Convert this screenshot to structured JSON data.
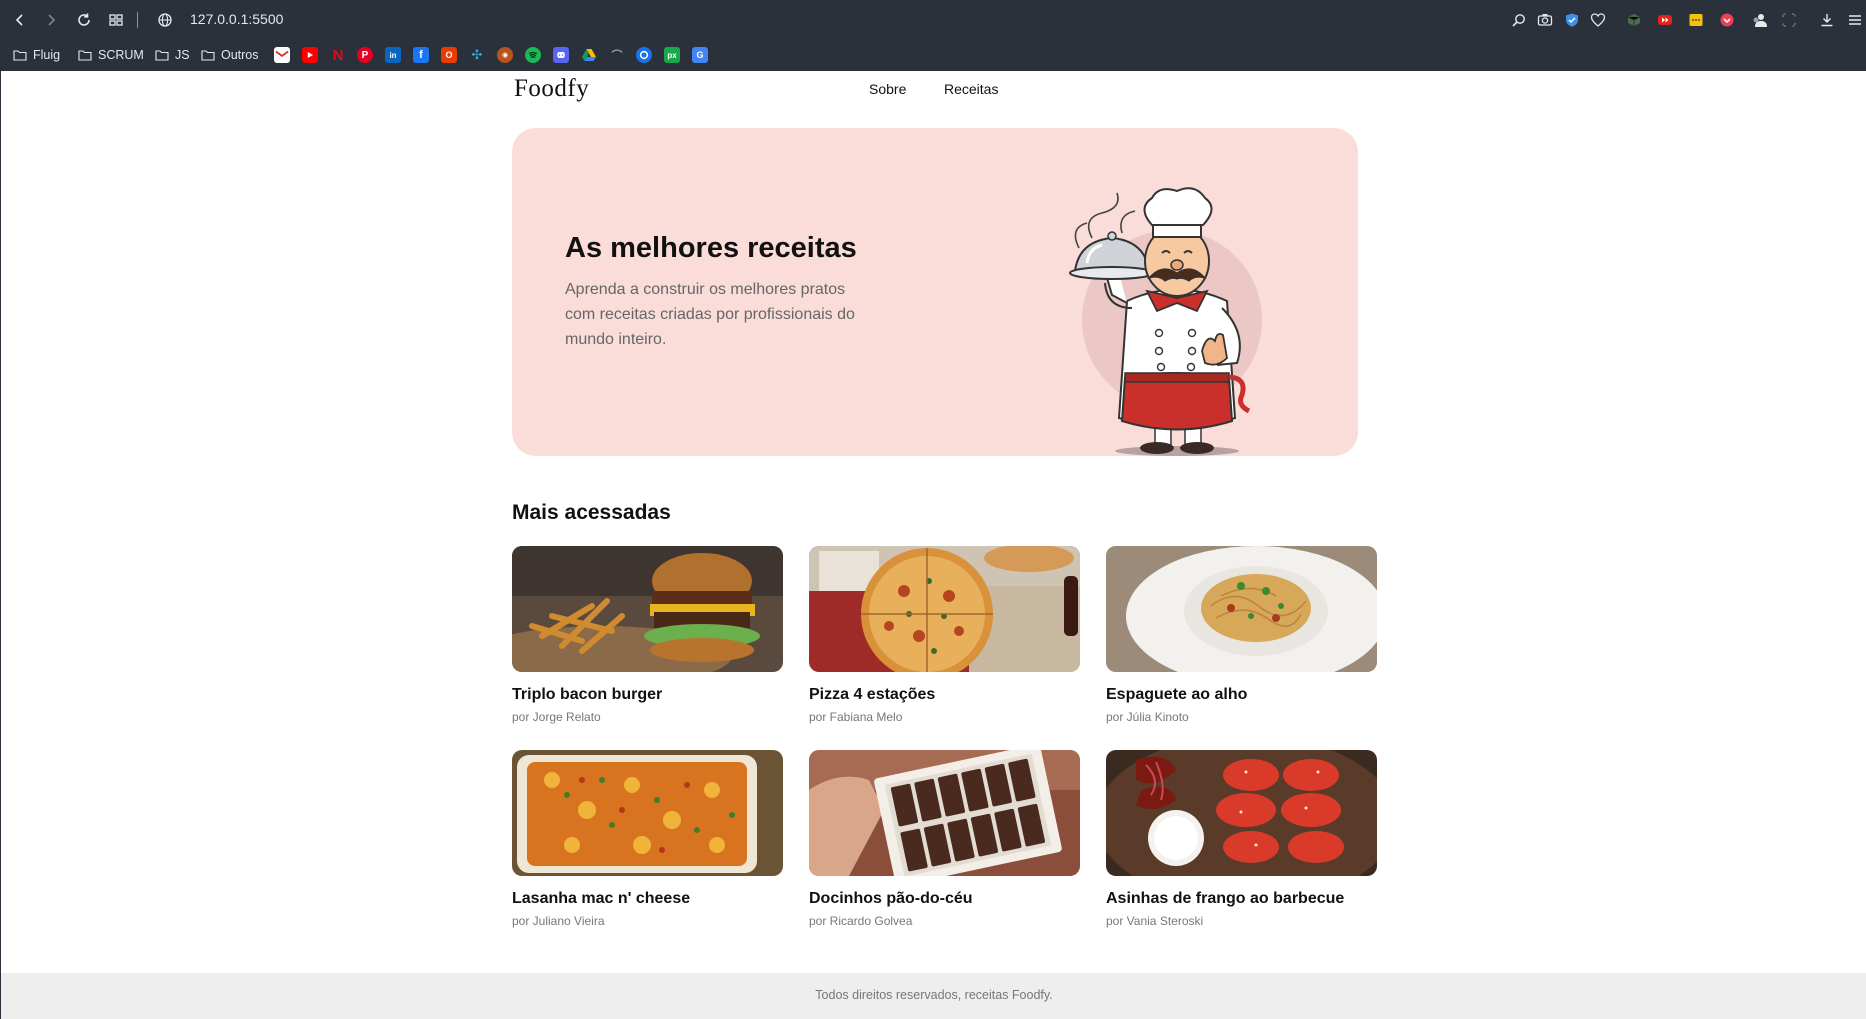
{
  "browser": {
    "url": "127.0.0.1:5500",
    "bookmarks": [
      {
        "label": "Fluig"
      },
      {
        "label": "SCRUM"
      },
      {
        "label": "JS"
      },
      {
        "label": "Outros"
      }
    ],
    "bookmark_icons": [
      "gmail-icon",
      "youtube-icon",
      "netflix-icon",
      "pinterest-icon",
      "linkedin-icon",
      "facebook-icon",
      "office-icon",
      "trello-icon",
      "site-icon",
      "spotify-icon",
      "discord-icon",
      "drive-icon",
      "bookmark-icon",
      "google-icon",
      "pix-icon",
      "translate-icon"
    ]
  },
  "site": {
    "logo": "Foodfy",
    "nav": [
      {
        "label": "Sobre"
      },
      {
        "label": "Receitas"
      }
    ]
  },
  "hero": {
    "title": "As melhores receitas",
    "description": "Aprenda a construir os melhores pratos com receitas criadas por profissionais do mundo inteiro."
  },
  "section": {
    "title": "Mais acessadas"
  },
  "recipes": [
    {
      "title": "Triplo bacon burger",
      "author": "por Jorge Relato"
    },
    {
      "title": "Pizza 4 estações",
      "author": "por Fabiana Melo"
    },
    {
      "title": "Espaguete ao alho",
      "author": "por Júlia Kinoto"
    },
    {
      "title": "Lasanha mac n' cheese",
      "author": "por Juliano Vieira"
    },
    {
      "title": "Docinhos pão-do-céu",
      "author": "por Ricardo Golvea"
    },
    {
      "title": "Asinhas de frango ao barbecue",
      "author": "por Vania Steroski"
    }
  ],
  "footer": {
    "text": "Todos direitos reservados, receitas Foodfy."
  },
  "colors": {
    "hero_background": "#fadcd9",
    "chrome_background": "#2b313b",
    "footer_background": "#eeeeee"
  }
}
